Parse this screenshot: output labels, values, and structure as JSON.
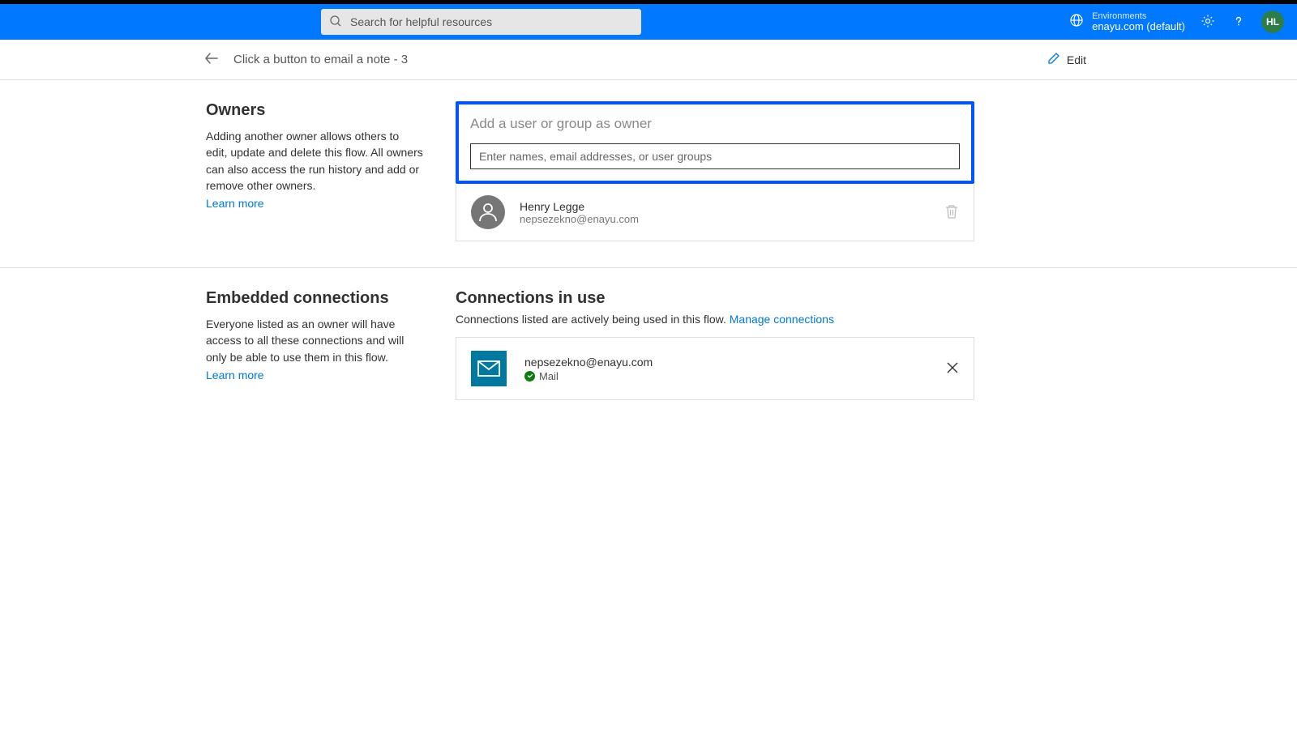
{
  "header": {
    "search_placeholder": "Search for helpful resources",
    "env_label": "Environments",
    "env_name": "enayu.com (default)",
    "avatar_initials": "HL"
  },
  "subheader": {
    "title": "Click a button to email a note - 3",
    "edit_label": "Edit"
  },
  "owners": {
    "heading": "Owners",
    "description": "Adding another owner allows others to edit, update and delete this flow. All owners can also access the run history and add or remove other owners.",
    "learn_more": "Learn more",
    "add_title": "Add a user or group as owner",
    "input_placeholder": "Enter names, email addresses, or user groups",
    "list": [
      {
        "name": "Henry Legge",
        "email": "nepsezekno@enayu.com"
      }
    ]
  },
  "connections": {
    "left_heading": "Embedded connections",
    "left_description": "Everyone listed as an owner will have access to all these connections and will only be able to use them in this flow.",
    "learn_more": "Learn more",
    "heading": "Connections in use",
    "description": "Connections listed are actively being used in this flow. ",
    "manage_link": "Manage connections",
    "list": [
      {
        "email": "nepsezekno@enayu.com",
        "service": "Mail"
      }
    ]
  }
}
